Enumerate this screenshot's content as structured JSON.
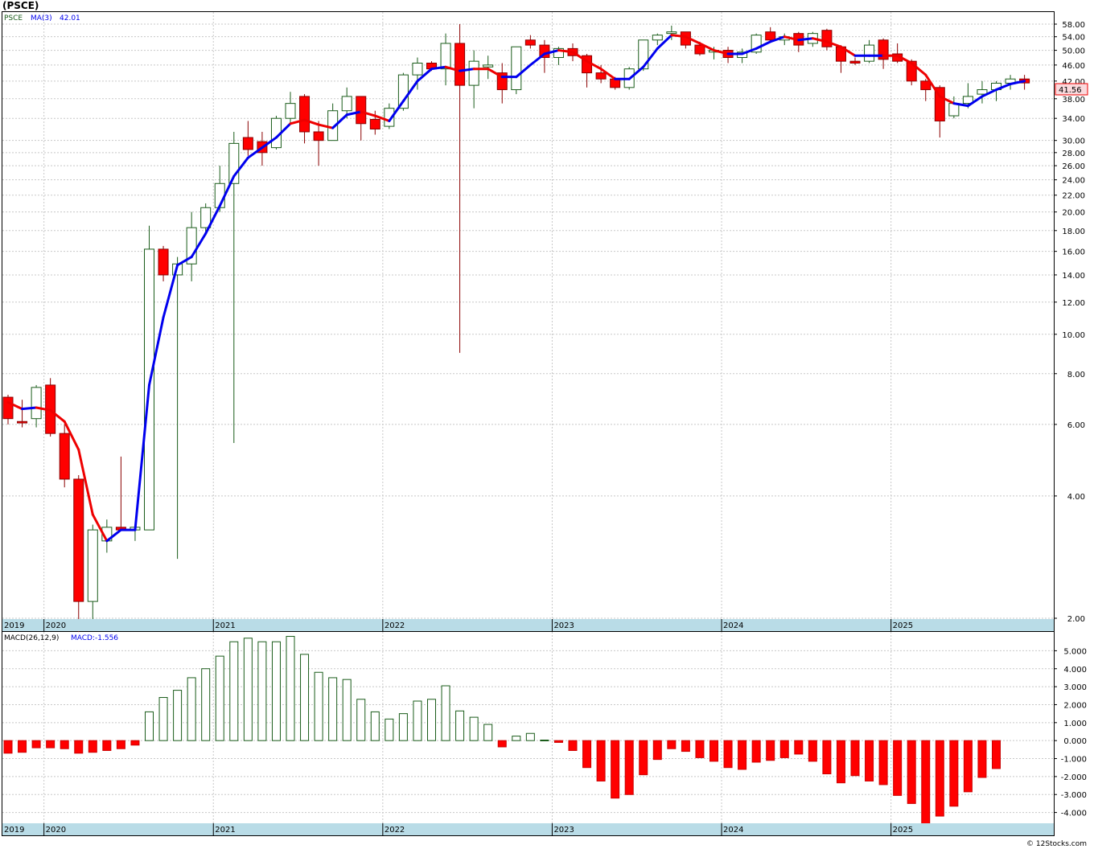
{
  "title": "(PSCE)",
  "price_legend": {
    "symbol": "PSCE",
    "ma_label": "MA(3)",
    "ma_value": "42.01"
  },
  "macd_legend": {
    "label": "MACD(26,12,9)",
    "value_label": "MACD:-1.556"
  },
  "last_price": "41.56",
  "footer": "© 12Stocks.com",
  "colors": {
    "up": "#1a5c1a",
    "down": "#ff0000",
    "ma_up": "#0000ee",
    "ma_down": "#ee0000",
    "axis_band": "#b9dce7",
    "grid": "#c8c8c8",
    "price_tag": "#fadadd"
  },
  "chart_data": [
    {
      "type": "candlestick",
      "scale": "log",
      "ylim": [
        2.0,
        58.0
      ],
      "y_ticks": [
        "2.00",
        "4.00",
        "6.00",
        "8.00",
        "10.00",
        "12.00",
        "14.00",
        "16.00",
        "18.00",
        "20.00",
        "22.00",
        "24.00",
        "26.00",
        "28.00",
        "30.00",
        "34.00",
        "38.00",
        "42.00",
        "46.00",
        "50.00",
        "54.00",
        "58.00"
      ],
      "x_labels": [
        "2019",
        "2020",
        "2021",
        "2022",
        "2023",
        "2024",
        "2025"
      ],
      "ma_name": "MA(3)",
      "candles": [
        {
          "o": 7.0,
          "h": 7.1,
          "l": 6.0,
          "c": 6.2
        },
        {
          "o": 6.1,
          "h": 6.9,
          "l": 5.9,
          "c": 6.05
        },
        {
          "o": 6.2,
          "h": 7.5,
          "l": 5.9,
          "c": 7.4
        },
        {
          "o": 7.5,
          "h": 7.8,
          "l": 5.6,
          "c": 5.7
        },
        {
          "o": 5.7,
          "h": 6.0,
          "l": 4.2,
          "c": 4.4
        },
        {
          "o": 4.4,
          "h": 4.5,
          "l": 1.85,
          "c": 2.2
        },
        {
          "o": 2.2,
          "h": 3.4,
          "l": 1.9,
          "c": 3.3
        },
        {
          "o": 3.1,
          "h": 3.5,
          "l": 2.9,
          "c": 3.35
        },
        {
          "o": 3.35,
          "h": 5.0,
          "l": 3.3,
          "c": 3.3
        },
        {
          "o": 3.3,
          "h": 3.4,
          "l": 3.1,
          "c": 3.35
        },
        {
          "o": 3.3,
          "h": 18.5,
          "l": 3.3,
          "c": 16.2
        },
        {
          "o": 16.2,
          "h": 16.5,
          "l": 13.5,
          "c": 14.0
        },
        {
          "o": 14.0,
          "h": 15.5,
          "l": 2.8,
          "c": 14.9
        },
        {
          "o": 14.9,
          "h": 20.0,
          "l": 13.5,
          "c": 18.3
        },
        {
          "o": 18.3,
          "h": 21.0,
          "l": 17.5,
          "c": 20.5
        },
        {
          "o": 20.5,
          "h": 26.0,
          "l": 20.0,
          "c": 23.5
        },
        {
          "o": 23.5,
          "h": 31.5,
          "l": 5.4,
          "c": 29.5
        },
        {
          "o": 30.5,
          "h": 33.5,
          "l": 27.5,
          "c": 28.5
        },
        {
          "o": 29.8,
          "h": 31.5,
          "l": 26.0,
          "c": 28.0
        },
        {
          "o": 28.8,
          "h": 34.5,
          "l": 28.5,
          "c": 34.0
        },
        {
          "o": 34.0,
          "h": 39.5,
          "l": 33.0,
          "c": 37.0
        },
        {
          "o": 38.5,
          "h": 39.0,
          "l": 29.5,
          "c": 31.5
        },
        {
          "o": 31.5,
          "h": 33.5,
          "l": 26.0,
          "c": 30.0
        },
        {
          "o": 30.0,
          "h": 37.0,
          "l": 30.0,
          "c": 35.5
        },
        {
          "o": 35.5,
          "h": 40.5,
          "l": 34.0,
          "c": 38.5
        },
        {
          "o": 38.5,
          "h": 38.5,
          "l": 30.0,
          "c": 33.0
        },
        {
          "o": 33.8,
          "h": 35.5,
          "l": 31.0,
          "c": 32.0
        },
        {
          "o": 32.5,
          "h": 37.0,
          "l": 32.0,
          "c": 36.0
        },
        {
          "o": 36.0,
          "h": 44.0,
          "l": 35.5,
          "c": 43.5
        },
        {
          "o": 43.5,
          "h": 48.0,
          "l": 40.0,
          "c": 46.5
        },
        {
          "o": 46.5,
          "h": 47.0,
          "l": 44.5,
          "c": 45.0
        },
        {
          "o": 45.0,
          "h": 55.0,
          "l": 41.0,
          "c": 52.0
        },
        {
          "o": 52.0,
          "h": 58.0,
          "l": 9.0,
          "c": 41.0
        },
        {
          "o": 41.0,
          "h": 50.0,
          "l": 36.0,
          "c": 47.0
        },
        {
          "o": 45.5,
          "h": 48.5,
          "l": 42.5,
          "c": 46.0
        },
        {
          "o": 44.0,
          "h": 46.5,
          "l": 37.0,
          "c": 40.0
        },
        {
          "o": 40.0,
          "h": 51.0,
          "l": 39.0,
          "c": 51.0
        },
        {
          "o": 53.0,
          "h": 54.5,
          "l": 50.5,
          "c": 51.5
        },
        {
          "o": 51.5,
          "h": 53.0,
          "l": 44.0,
          "c": 48.0
        },
        {
          "o": 48.0,
          "h": 51.0,
          "l": 46.0,
          "c": 50.5
        },
        {
          "o": 50.5,
          "h": 52.0,
          "l": 47.0,
          "c": 48.5
        },
        {
          "o": 48.5,
          "h": 49.0,
          "l": 40.5,
          "c": 44.0
        },
        {
          "o": 44.0,
          "h": 46.0,
          "l": 41.5,
          "c": 42.5
        },
        {
          "o": 42.5,
          "h": 43.0,
          "l": 40.0,
          "c": 40.5
        },
        {
          "o": 40.5,
          "h": 45.5,
          "l": 40.0,
          "c": 45.0
        },
        {
          "o": 45.0,
          "h": 53.0,
          "l": 44.5,
          "c": 53.0
        },
        {
          "o": 53.0,
          "h": 55.0,
          "l": 51.5,
          "c": 54.5
        },
        {
          "o": 55.0,
          "h": 57.5,
          "l": 53.0,
          "c": 55.5
        },
        {
          "o": 55.5,
          "h": 55.5,
          "l": 50.5,
          "c": 51.5
        },
        {
          "o": 51.5,
          "h": 52.5,
          "l": 48.5,
          "c": 49.0
        },
        {
          "o": 49.5,
          "h": 51.0,
          "l": 47.5,
          "c": 50.0
        },
        {
          "o": 50.0,
          "h": 51.0,
          "l": 46.5,
          "c": 48.0
        },
        {
          "o": 48.0,
          "h": 50.5,
          "l": 46.5,
          "c": 49.5
        },
        {
          "o": 49.5,
          "h": 55.0,
          "l": 49.0,
          "c": 54.5
        },
        {
          "o": 55.5,
          "h": 57.0,
          "l": 52.5,
          "c": 53.0
        },
        {
          "o": 53.0,
          "h": 55.0,
          "l": 51.5,
          "c": 54.0
        },
        {
          "o": 55.0,
          "h": 55.5,
          "l": 49.5,
          "c": 51.5
        },
        {
          "o": 52.0,
          "h": 55.5,
          "l": 51.0,
          "c": 55.0
        },
        {
          "o": 56.0,
          "h": 56.5,
          "l": 50.0,
          "c": 51.0
        },
        {
          "o": 51.0,
          "h": 51.5,
          "l": 44.0,
          "c": 47.0
        },
        {
          "o": 47.0,
          "h": 48.0,
          "l": 46.0,
          "c": 46.5
        },
        {
          "o": 47.0,
          "h": 53.0,
          "l": 46.5,
          "c": 51.5
        },
        {
          "o": 53.0,
          "h": 53.5,
          "l": 45.0,
          "c": 47.5
        },
        {
          "o": 49.0,
          "h": 52.0,
          "l": 46.5,
          "c": 47.0
        },
        {
          "o": 47.0,
          "h": 47.5,
          "l": 41.0,
          "c": 42.0
        },
        {
          "o": 42.0,
          "h": 42.5,
          "l": 37.5,
          "c": 40.0
        },
        {
          "o": 40.5,
          "h": 41.0,
          "l": 30.5,
          "c": 33.5
        },
        {
          "o": 34.5,
          "h": 38.5,
          "l": 34.0,
          "c": 37.0
        },
        {
          "o": 37.0,
          "h": 41.5,
          "l": 36.0,
          "c": 38.5
        },
        {
          "o": 39.0,
          "h": 42.0,
          "l": 37.0,
          "c": 40.0
        },
        {
          "o": 40.0,
          "h": 42.0,
          "l": 37.5,
          "c": 41.5
        },
        {
          "o": 41.5,
          "h": 43.5,
          "l": 40.0,
          "c": 42.5
        },
        {
          "o": 42.5,
          "h": 43.5,
          "l": 40.0,
          "c": 41.56
        }
      ],
      "ma": [
        6.8,
        6.55,
        6.6,
        6.5,
        6.1,
        5.2,
        3.6,
        3.1,
        3.3,
        3.3,
        7.5,
        11.0,
        14.8,
        15.5,
        17.7,
        20.7,
        24.5,
        27.2,
        28.8,
        30.5,
        33.0,
        33.7,
        32.8,
        32.2,
        34.7,
        35.3,
        34.5,
        33.5,
        37.5,
        42.0,
        45.0,
        45.5,
        44.5,
        45.0,
        45.0,
        43.0,
        43.0,
        46.0,
        49.0,
        50.0,
        49.5,
        47.0,
        45.0,
        42.5,
        42.5,
        45.5,
        50.5,
        54.5,
        54.0,
        52.0,
        50.0,
        49.0,
        49.0,
        50.5,
        52.5,
        54.0,
        53.0,
        53.5,
        52.5,
        51.0,
        48.5,
        48.5,
        48.5,
        48.5,
        46.5,
        43.5,
        38.5,
        37.0,
        36.5,
        38.5,
        40.0,
        41.3,
        42.01
      ],
      "ma_up": [
        false,
        false,
        true,
        false,
        false,
        false,
        false,
        false,
        true,
        true,
        true,
        true,
        true,
        true,
        true,
        true,
        true,
        true,
        true,
        true,
        true,
        false,
        false,
        false,
        true,
        true,
        false,
        false,
        true,
        true,
        true,
        true,
        false,
        true,
        false,
        false,
        true,
        true,
        true,
        true,
        false,
        false,
        false,
        false,
        true,
        true,
        true,
        true,
        false,
        false,
        false,
        false,
        true,
        true,
        true,
        true,
        false,
        true,
        false,
        false,
        false,
        true,
        true,
        false,
        false,
        false,
        false,
        false,
        true,
        true,
        true,
        true,
        true
      ]
    },
    {
      "type": "bar",
      "name": "MACD(26,12,9)",
      "ylim": [
        -4.6,
        5.6
      ],
      "y_ticks": [
        "5.000",
        "4.000",
        "3.000",
        "2.000",
        "1.000",
        "0.000",
        "-1.000",
        "-2.000",
        "-3.000",
        "-4.000"
      ],
      "x_labels": [
        "2019",
        "2020",
        "2021",
        "2022",
        "2023",
        "2024",
        "2025"
      ],
      "values": [
        -0.7,
        -0.65,
        -0.4,
        -0.4,
        -0.45,
        -0.7,
        -0.65,
        -0.55,
        -0.45,
        -0.25,
        1.6,
        2.4,
        2.8,
        3.5,
        4.0,
        4.7,
        5.5,
        5.7,
        5.5,
        5.5,
        5.8,
        4.8,
        3.8,
        3.5,
        3.4,
        2.3,
        1.6,
        1.2,
        1.5,
        2.2,
        2.3,
        3.05,
        1.65,
        1.3,
        0.9,
        -0.35,
        0.25,
        0.4,
        0.03,
        -0.1,
        -0.55,
        -1.5,
        -2.25,
        -3.2,
        -3.0,
        -1.9,
        -1.05,
        -0.45,
        -0.6,
        -0.95,
        -1.15,
        -1.5,
        -1.6,
        -1.2,
        -1.1,
        -0.95,
        -0.75,
        -1.15,
        -1.85,
        -2.35,
        -1.95,
        -2.25,
        -2.45,
        -3.05,
        -3.5,
        -4.7,
        -4.2,
        -3.65,
        -2.85,
        -2.05,
        -1.556
      ]
    }
  ]
}
